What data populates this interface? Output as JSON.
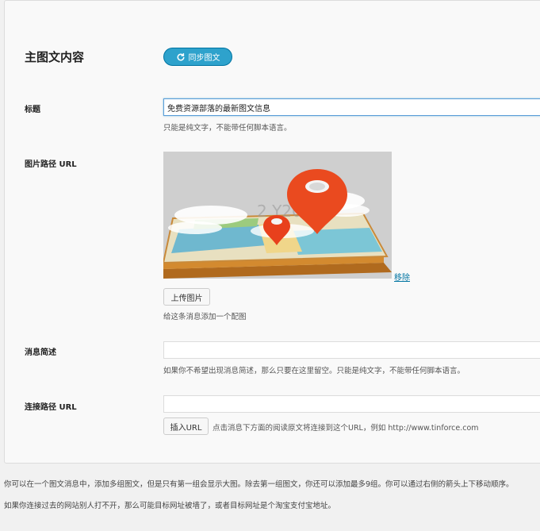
{
  "section": {
    "heading": "主图文内容",
    "sync_button": "同步图文"
  },
  "fields": {
    "title": {
      "label": "标题",
      "value": "免费资源部落的最新图文信息",
      "hint": "只能是纯文字，不能带任何脚本语言。"
    },
    "image": {
      "label": "图片路径 URL",
      "remove_link": "移除",
      "upload_button": "上传图片",
      "hint": "给这条消息添加一个配图",
      "watermark": "2 Y200"
    },
    "summary": {
      "label": "消息简述",
      "value": "",
      "hint": "如果你不希望出现消息简述，那么只要在这里留空。只能是纯文字，不能带任何脚本语言。"
    },
    "link": {
      "label": "连接路径 URL",
      "value": "",
      "insert_button": "插入URL",
      "hint": "点击消息下方面的阅读原文将连接到这个URL，例如 http://www.tinforce.com"
    }
  },
  "footer": {
    "note1": "你可以在一个图文消息中，添加多组图文，但是只有第一组会显示大图。除去第一组图文，你还可以添加最多9组。你可以通过右侧的箭头上下移动顺序。",
    "note2": "如果你连接过去的网站别人打不开，那么可能目标网址被墙了，或者目标网址是个淘宝支付宝地址。"
  },
  "colors": {
    "accent": "#2ea2cc",
    "link": "#0074a2",
    "focus_border": "#5b9dd9"
  },
  "icons": {
    "sync": "refresh-icon",
    "image": "map-pin-illustration"
  }
}
